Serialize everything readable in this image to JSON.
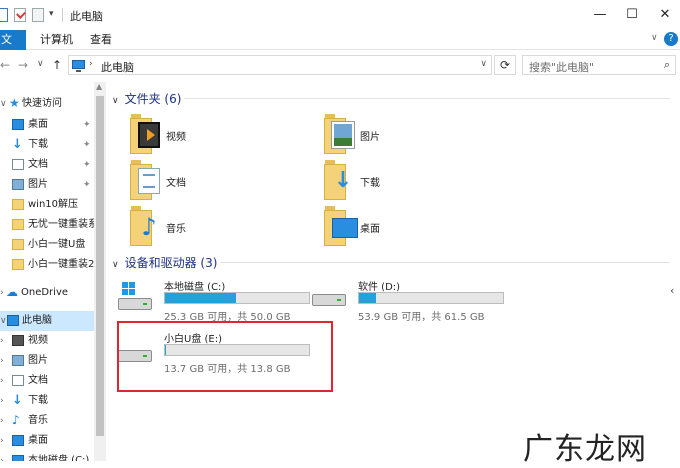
{
  "window": {
    "title": "此电脑",
    "minimize": "—",
    "maximize": "☐",
    "close": "✕"
  },
  "ribbon": {
    "tabs": [
      "文件",
      "计算机",
      "查看"
    ],
    "toggle": "∨",
    "help": "?"
  },
  "address": {
    "back": "←",
    "forward": "→",
    "recent": "∨",
    "up": "↑",
    "path_sep": "›",
    "path": "此电脑",
    "dropdown": "∨",
    "refresh": "⟳",
    "search_placeholder": "搜索\"此电脑\"",
    "search_icon": "⌕"
  },
  "nav_pane": {
    "items": [
      {
        "label": "快速访问",
        "icon": "star-icon",
        "pinned": false
      },
      {
        "label": "桌面",
        "icon": "desktop-icon",
        "pinned": true
      },
      {
        "label": "下载",
        "icon": "download-icon",
        "pinned": true
      },
      {
        "label": "文档",
        "icon": "document-icon",
        "pinned": true
      },
      {
        "label": "图片",
        "icon": "picture-icon",
        "pinned": true
      },
      {
        "label": "win10解压",
        "icon": "folder-icon",
        "pinned": false
      },
      {
        "label": "无忧一键重装系",
        "icon": "folder-icon",
        "pinned": false
      },
      {
        "label": "小白一键U盘",
        "icon": "folder-icon",
        "pinned": false
      },
      {
        "label": "小白一键重装2",
        "icon": "folder-icon",
        "pinned": false
      },
      {
        "label": "OneDrive",
        "icon": "cloud-icon",
        "pinned": false
      },
      {
        "label": "此电脑",
        "icon": "computer-icon",
        "pinned": false
      },
      {
        "label": "视频",
        "icon": "video-icon",
        "pinned": false
      },
      {
        "label": "图片",
        "icon": "picture-icon",
        "pinned": false
      },
      {
        "label": "文档",
        "icon": "document-icon",
        "pinned": false
      },
      {
        "label": "下载",
        "icon": "download-icon",
        "pinned": false
      },
      {
        "label": "音乐",
        "icon": "music-icon",
        "pinned": false
      },
      {
        "label": "桌面",
        "icon": "desktop-icon",
        "pinned": false
      },
      {
        "label": "本地磁盘 (C:)",
        "icon": "drive-icon",
        "pinned": false
      }
    ],
    "pin_glyph": "📌",
    "expand_glyph": "›",
    "collapse_glyph": "∨"
  },
  "content": {
    "folders_group": "文件夹 (6)",
    "folders": [
      "视频",
      "图片",
      "文档",
      "下载",
      "音乐",
      "桌面"
    ],
    "drives_group": "设备和驱动器 (3)",
    "drives": [
      {
        "name": "本地磁盘 (C:)",
        "info": "25.3 GB 可用，共 50.0 GB",
        "used_fraction": 0.49,
        "icon": "windows-drive-icon"
      },
      {
        "name": "软件 (D:)",
        "info": "53.9 GB 可用，共 61.5 GB",
        "used_fraction": 0.12,
        "icon": "hard-drive-icon"
      },
      {
        "name": "小白U盘 (E:)",
        "info": "13.7 GB 可用，共 13.8 GB",
        "used_fraction": 0.01,
        "icon": "usb-drive-icon"
      }
    ],
    "right_arrow": "‹"
  },
  "watermark": "广东龙网",
  "colors": {
    "accent": "#1979ca",
    "bar_fill": "#26a0da",
    "highlight_box": "#e0262e",
    "selected_nav": "#cce8ff"
  }
}
